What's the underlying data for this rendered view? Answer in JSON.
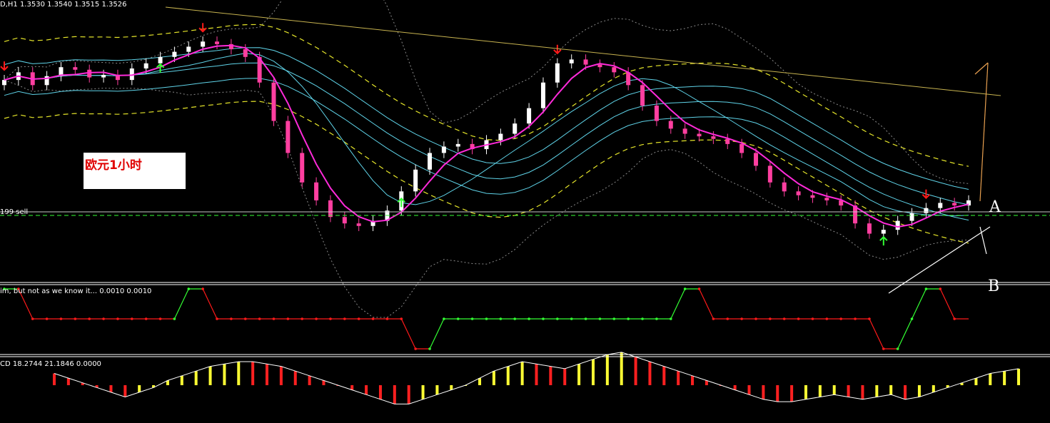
{
  "header": {
    "symbol_line": "D,H1  1.3530 1.3540 1.3515 1.3526",
    "order_line": "199 sell"
  },
  "note": {
    "text": "欧元1小时"
  },
  "markers": {
    "a": "A",
    "b": "B"
  },
  "indicator1": {
    "label": "im, but not as we know it...  0.0010 0.0010"
  },
  "indicator2": {
    "label": "CD 18.2744 21.1846 0.0000"
  },
  "colors": {
    "background": "#000000",
    "bull_candle": "#ffffff",
    "bear_candle": "#ff3fa0",
    "ma_magenta": "#ff2ad9",
    "ma_cyan": "#5fd3e8",
    "bands_yellow": "#e5e52a",
    "bands_gray": "#8a8a8a",
    "trendline": "#c8b450",
    "signal_up": "#33ff33",
    "signal_down": "#ff1a1a",
    "hist_red": "#ff2020",
    "hist_yellow": "#ffff33"
  },
  "chart_data": [
    {
      "type": "line",
      "panel": "price",
      "series": [
        {
          "values": [
            1.3512,
            1.3518,
            1.3508,
            1.3515,
            1.3522,
            1.352,
            1.3514,
            1.3516,
            1.3512,
            1.3521,
            1.3525,
            1.353,
            1.3534,
            1.3538,
            1.3542,
            1.354,
            1.3536,
            1.353,
            1.351,
            1.348,
            1.3455,
            1.3432,
            1.3418,
            1.3405,
            1.34,
            1.3398,
            1.3402,
            1.341,
            1.3425,
            1.3442,
            1.3455,
            1.346,
            1.3462,
            1.3458,
            1.3465,
            1.347,
            1.3478,
            1.349,
            1.351,
            1.3525,
            1.3528,
            1.3524,
            1.3522,
            1.3518,
            1.3508,
            1.3492,
            1.348,
            1.3474,
            1.347,
            1.3468,
            1.3466,
            1.3462,
            1.3455,
            1.3445,
            1.3432,
            1.3425,
            1.3422,
            1.342,
            1.3418,
            1.3414,
            1.34,
            1.3392,
            1.3395,
            1.3402,
            1.3408,
            1.3412,
            1.3416,
            1.3414,
            1.3418
          ]
        }
      ]
    },
    {
      "type": "line",
      "panel": "indicator1",
      "series": [
        {
          "values": [
            1,
            1,
            0,
            0,
            0,
            0,
            0,
            0,
            0,
            0,
            0,
            0,
            0,
            1,
            1,
            0,
            0,
            0,
            0,
            0,
            0,
            0,
            0,
            0,
            0,
            0,
            0,
            0,
            0,
            -1,
            -1,
            0,
            0,
            0,
            0,
            0,
            0,
            0,
            0,
            0,
            0,
            0,
            0,
            0,
            0,
            0,
            0,
            0,
            1,
            1,
            0,
            0,
            0,
            0,
            0,
            0,
            0,
            0,
            0,
            0,
            0,
            0,
            -1,
            -1,
            0,
            1,
            1,
            0,
            0
          ]
        }
      ]
    },
    {
      "type": "bar",
      "panel": "indicator2",
      "series": [
        {
          "values": [
            5,
            3,
            1,
            -1,
            -3,
            -5,
            -3,
            -1,
            2,
            4,
            6,
            8,
            9,
            10,
            10,
            9,
            8,
            6,
            4,
            2,
            0,
            -2,
            -4,
            -6,
            -8,
            -8,
            -6,
            -4,
            -2,
            0,
            3,
            6,
            8,
            10,
            9,
            8,
            7,
            9,
            11,
            13,
            14,
            12,
            10,
            8,
            6,
            4,
            2,
            0,
            -2,
            -4,
            -6,
            -7,
            -7,
            -6,
            -5,
            -4,
            -5,
            -6,
            -5,
            -4,
            -6,
            -5,
            -3,
            -1,
            1,
            3,
            5,
            6,
            7
          ]
        }
      ]
    }
  ]
}
